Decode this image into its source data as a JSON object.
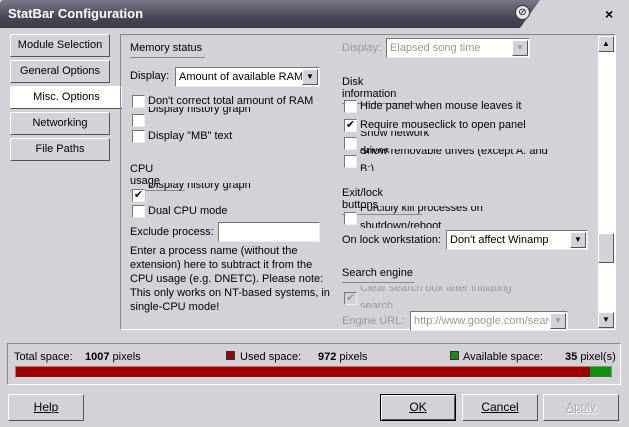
{
  "window": {
    "title": "StatBar Configuration",
    "close": "×",
    "pin": "⊘"
  },
  "nav": [
    "Module Selection",
    "General Options",
    "Misc. Options",
    "Networking",
    "File Paths"
  ],
  "memory": {
    "header": "Memory status",
    "display_label": "Display:",
    "display_value": "Amount of available RAM",
    "checks": [
      {
        "label": "Don't correct total amount of RAM",
        "checked": false
      },
      {
        "label": "Display history graph",
        "checked": false
      },
      {
        "label": "Display \"MB\" text",
        "checked": false
      }
    ]
  },
  "cpu": {
    "header": "CPU usage",
    "checks": [
      {
        "label": "Display history graph",
        "checked": true
      },
      {
        "label": "Dual CPU mode",
        "checked": false
      }
    ],
    "exclude_label": "Exclude process:",
    "exclude_value": "",
    "note": "Enter a process name (without the extension) here to subtract it from the CPU usage (e.g. DNETC). Please note: This only works on NT-based systems, in single-CPU mode!"
  },
  "winamp": {
    "display_label": "Display:",
    "display_value": "Elapsed song time"
  },
  "disk": {
    "header": "Disk information",
    "checks": [
      {
        "label": "Hide panel when mouse leaves it",
        "checked": false
      },
      {
        "label": "Require mouseclick to open panel",
        "checked": true
      },
      {
        "label": "Show network drives",
        "checked": false
      },
      {
        "label": "Show removable drives (except A: and B:)",
        "checked": false
      }
    ]
  },
  "exitlock": {
    "header": "Exit/lock buttons",
    "checks": [
      {
        "label": "Forcibly kill processes on shutdown/reboot",
        "checked": false
      }
    ],
    "lock_label": "On lock workstation:",
    "lock_value": "Don't affect Winamp"
  },
  "search": {
    "header": "Search engine",
    "checks": [
      {
        "label": "Clear search box after initiating search",
        "checked": true
      }
    ],
    "url_label": "Engine URL:",
    "url_value": "http://www.google.com/search"
  },
  "space": {
    "total_label": "Total space:",
    "total_value": "1007",
    "total_unit": "pixels",
    "used_label": "Used space:",
    "used_value": "972",
    "used_unit": "pixels",
    "avail_label": "Available space:",
    "avail_value": "35",
    "avail_unit": "pixel(s)",
    "used_color": "#a00000",
    "avail_color": "#109010",
    "used_fraction": 0.965
  },
  "buttons": {
    "help": "Help",
    "ok": "OK",
    "cancel": "Cancel",
    "apply": "Apply"
  }
}
